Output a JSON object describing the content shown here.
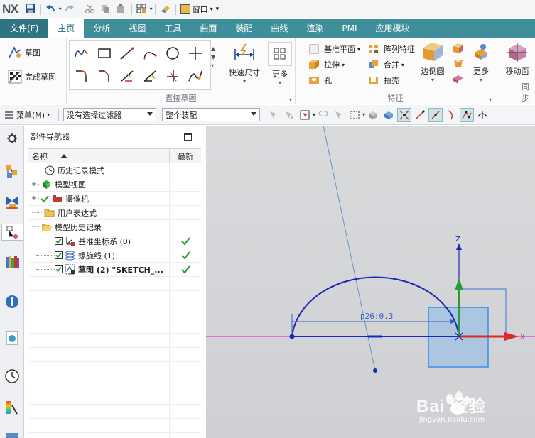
{
  "app": {
    "logo": "NX",
    "window_menu": "窗口"
  },
  "tabs": [
    {
      "label": "文件(F)"
    },
    {
      "label": "主页"
    },
    {
      "label": "分析"
    },
    {
      "label": "视图"
    },
    {
      "label": "工具"
    },
    {
      "label": "曲面"
    },
    {
      "label": "装配"
    },
    {
      "label": "曲线"
    },
    {
      "label": "渲染"
    },
    {
      "label": "PMI"
    },
    {
      "label": "应用模块"
    }
  ],
  "ribbon": {
    "sketch": {
      "sketch_label": "草图",
      "finish_label": "完成草图"
    },
    "direct_sketch": {
      "group_label": "直接草图",
      "quick_dim": "快速尺寸",
      "more": "更多"
    },
    "feature": {
      "group_label": "特征",
      "datum_plane": "基准平面",
      "extrude": "拉伸",
      "hole": "孔",
      "pattern": "阵列特征",
      "unite": "合并",
      "shell": "抽壳",
      "edge_blend": "边倒圆",
      "more": "更多"
    },
    "sync": {
      "move_face": "移动面",
      "group_label_partial": "同步"
    }
  },
  "toolbar2": {
    "menu_label": "菜单(M)",
    "filter_value": "没有选择过滤器",
    "scope_value": "整个装配"
  },
  "navigator": {
    "title": "部件导航器",
    "col_name": "名称",
    "col_latest": "最新",
    "rows": [
      {
        "label": "历史记录模式"
      },
      {
        "label": "模型视图"
      },
      {
        "label": "摄像机"
      },
      {
        "label": "用户表达式"
      },
      {
        "label": "模型历史记录"
      },
      {
        "label": "基准坐标系 (0)"
      },
      {
        "label": "螺旋线 (1)"
      },
      {
        "label": "草图 (2) \"SKETCH_..."
      }
    ]
  },
  "viewport": {
    "dimension_label": "p26:0.3",
    "axis_z": "Z",
    "axis_x": "X",
    "watermark_main": "Bai 经验",
    "watermark_sub": "jingyan.baidu.com"
  }
}
